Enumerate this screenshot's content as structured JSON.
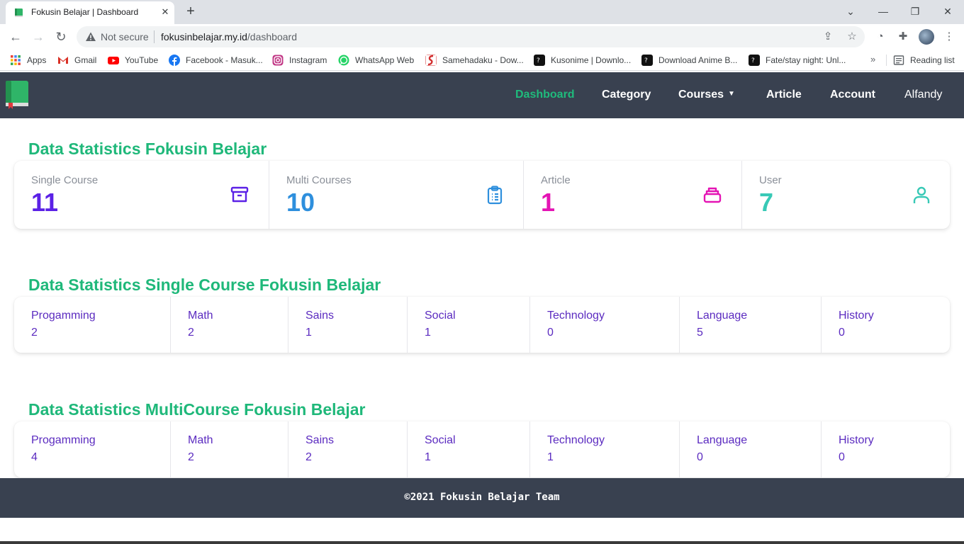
{
  "browser": {
    "tab_title": "Fokusin Belajar | Dashboard",
    "not_secure": "Not secure",
    "url_host": "fokusinbelajar.my.id",
    "url_path": "/dashboard",
    "bookmarks": [
      {
        "label": "Apps",
        "icon": "apps-grid-icon",
        "color": "#ea4335"
      },
      {
        "label": "Gmail",
        "icon": "gmail-icon",
        "color": "#d93025"
      },
      {
        "label": "YouTube",
        "icon": "youtube-icon",
        "color": "#ff0000"
      },
      {
        "label": "Facebook - Masuk...",
        "icon": "facebook-icon",
        "color": "#1877f2"
      },
      {
        "label": "Instagram",
        "icon": "instagram-icon",
        "color": "#c13584"
      },
      {
        "label": "WhatsApp Web",
        "icon": "whatsapp-icon",
        "color": "#25d366"
      },
      {
        "label": "Samehadaku - Dow...",
        "icon": "samehadaku-icon",
        "color": "#d32f2f"
      },
      {
        "label": "Kusonime | Downlo...",
        "icon": "kusonime-icon",
        "color": "#111111"
      },
      {
        "label": "Download Anime B...",
        "icon": "anime-icon",
        "color": "#111111"
      },
      {
        "label": "Fate/stay night: Unl...",
        "icon": "fate-icon",
        "color": "#111111"
      }
    ],
    "reading_list": "Reading list"
  },
  "nav": {
    "links": [
      "Dashboard",
      "Category",
      "Courses",
      "Article",
      "Account"
    ],
    "user": "Alfandy"
  },
  "overview": {
    "title": "Data Statistics Fokusin Belajar",
    "stats": [
      {
        "label": "Single Course",
        "value": "11",
        "icon": "archive-box-icon",
        "color": "#5b21e6"
      },
      {
        "label": "Multi Courses",
        "value": "10",
        "icon": "clipboard-list-icon",
        "color": "#2e8fdd"
      },
      {
        "label": "Article",
        "value": "1",
        "icon": "stack-icon",
        "color": "#e414b4"
      },
      {
        "label": "User",
        "value": "7",
        "icon": "user-icon",
        "color": "#38c9b6"
      }
    ]
  },
  "single": {
    "title": "Data Statistics Single Course Fokusin Belajar",
    "categories": [
      {
        "label": "Progamming",
        "value": "2"
      },
      {
        "label": "Math",
        "value": "2"
      },
      {
        "label": "Sains",
        "value": "1"
      },
      {
        "label": "Social",
        "value": "1"
      },
      {
        "label": "Technology",
        "value": "0"
      },
      {
        "label": "Language",
        "value": "5"
      },
      {
        "label": "History",
        "value": "0"
      }
    ]
  },
  "multi": {
    "title": "Data Statistics MultiCourse Fokusin Belajar",
    "categories": [
      {
        "label": "Progamming",
        "value": "4"
      },
      {
        "label": "Math",
        "value": "2"
      },
      {
        "label": "Sains",
        "value": "2"
      },
      {
        "label": "Social",
        "value": "1"
      },
      {
        "label": "Technology",
        "value": "1"
      },
      {
        "label": "Language",
        "value": "0"
      },
      {
        "label": "History",
        "value": "0"
      }
    ]
  },
  "footer": {
    "text": "©2021 Fokusin Belajar Team"
  },
  "colors": {
    "accent": "#1fb87a",
    "navbar": "#394150",
    "category_text": "#5b2bc0"
  }
}
